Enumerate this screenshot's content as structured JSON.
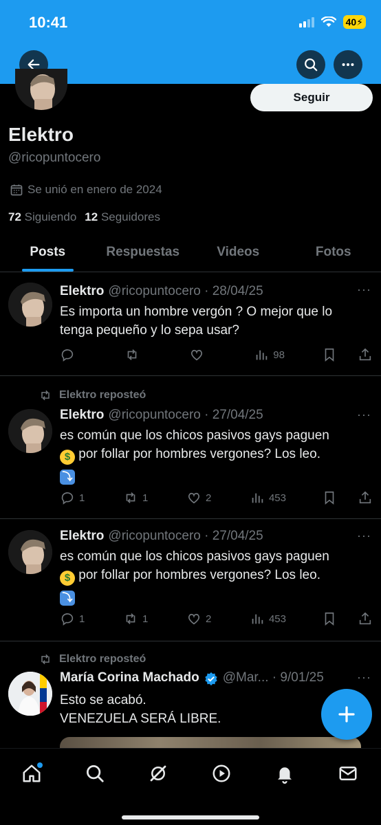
{
  "status": {
    "time": "10:41",
    "battery": "40"
  },
  "profile": {
    "follow_label": "Seguir",
    "name": "Elektro",
    "handle": "@ricopuntocero",
    "joined": "Se unió en enero de 2024",
    "following_count": "72",
    "following_label": "Siguiendo",
    "followers_count": "12",
    "followers_label": "Seguidores"
  },
  "tabs": [
    {
      "label": "Posts",
      "active": true
    },
    {
      "label": "Respuestas"
    },
    {
      "label": "Videos"
    },
    {
      "label": "Fotos"
    }
  ],
  "posts": [
    {
      "name": "Elektro",
      "meta": "@ricopuntocero · 28/04/25",
      "line1": "Es importa un hombre vergón ? O mejor que lo",
      "line2": "tenga pequeño y lo sepa usar?",
      "replies": "",
      "reposts": "",
      "likes": "",
      "views": "98"
    },
    {
      "repost_label": "Elektro reposteó",
      "name": "Elektro",
      "meta": "@ricopuntocero · 27/04/25",
      "line1": "es común que los chicos pasivos gays paguen",
      "line2": " por follar por hombres vergones? Los leo.",
      "replies": "1",
      "reposts": "1",
      "likes": "2",
      "views": "453"
    },
    {
      "name": "Elektro",
      "meta": "@ricopuntocero · 27/04/25",
      "line1": "es común que los chicos pasivos gays paguen",
      "line2": " por follar por hombres vergones? Los leo.",
      "replies": "1",
      "reposts": "1",
      "likes": "2",
      "views": "453"
    },
    {
      "repost_label": "Elektro reposteó",
      "name": "María Corina Machado",
      "meta": "@Mar... · 9/01/25",
      "line1": "Esto se acabó.",
      "line2": "VENEZUELA SERÁ LIBRE."
    }
  ],
  "colors": {
    "accent": "#1d9bf0",
    "muted": "#71767b",
    "text": "#e7e9ea"
  },
  "icons": [
    "back-arrow-icon",
    "search-icon",
    "more-icon",
    "calendar-icon",
    "reply-icon",
    "repost-icon",
    "like-icon",
    "views-icon",
    "bookmark-icon",
    "share-icon",
    "verified-icon",
    "plus-icon",
    "home-icon",
    "grok-icon",
    "play-icon",
    "bell-icon",
    "mail-icon"
  ]
}
